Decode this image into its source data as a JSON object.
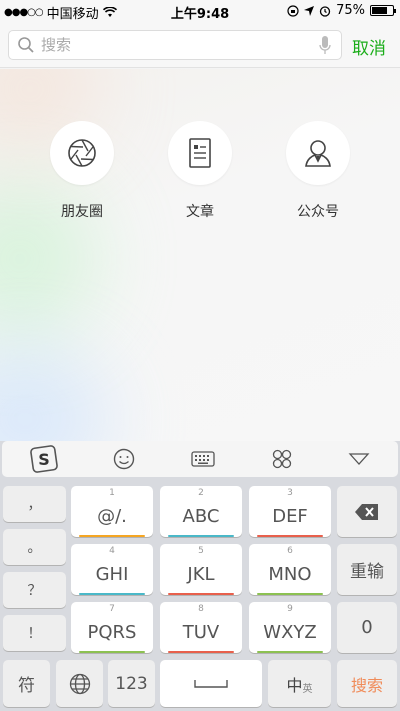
{
  "status_bar": {
    "carrier": "中国移动",
    "time": "上午9:48",
    "battery": "75%",
    "battery_level": 0.75
  },
  "search": {
    "placeholder": "搜索",
    "cancel_label": "取消"
  },
  "categories": [
    {
      "label": "朋友圈",
      "icon": "moments-aperture-icon"
    },
    {
      "label": "文章",
      "icon": "article-icon"
    },
    {
      "label": "公众号",
      "icon": "official-account-icon"
    }
  ],
  "keyboard": {
    "toolbar": [
      "sogou-logo-icon",
      "emoji-icon",
      "keyboard-icon",
      "clover-icon",
      "collapse-icon"
    ],
    "symbol_keys": [
      "，",
      "。",
      "？",
      "！"
    ],
    "letter_keys": [
      {
        "num": "1",
        "label": "@/.",
        "color": "#f5a623"
      },
      {
        "num": "2",
        "label": "ABC",
        "color": "#4ab8c8"
      },
      {
        "num": "3",
        "label": "DEF",
        "color": "#e8604c"
      },
      {
        "num": "4",
        "label": "GHI",
        "color": "#4ab8c8"
      },
      {
        "num": "5",
        "label": "JKL",
        "color": "#e8604c"
      },
      {
        "num": "6",
        "label": "MNO",
        "color": "#8cc152"
      },
      {
        "num": "7",
        "label": "PQRS",
        "color": "#8cc152"
      },
      {
        "num": "8",
        "label": "TUV",
        "color": "#e8604c"
      },
      {
        "num": "9",
        "label": "WXYZ",
        "color": "#8cc152"
      }
    ],
    "right_keys": {
      "retype": "重输",
      "zero": "0"
    },
    "bottom_row": {
      "symbol": "符",
      "numbers": "123",
      "lang_cn": "中",
      "lang_en": "英",
      "search": "搜索"
    },
    "accent_color": "#f08c5a"
  }
}
